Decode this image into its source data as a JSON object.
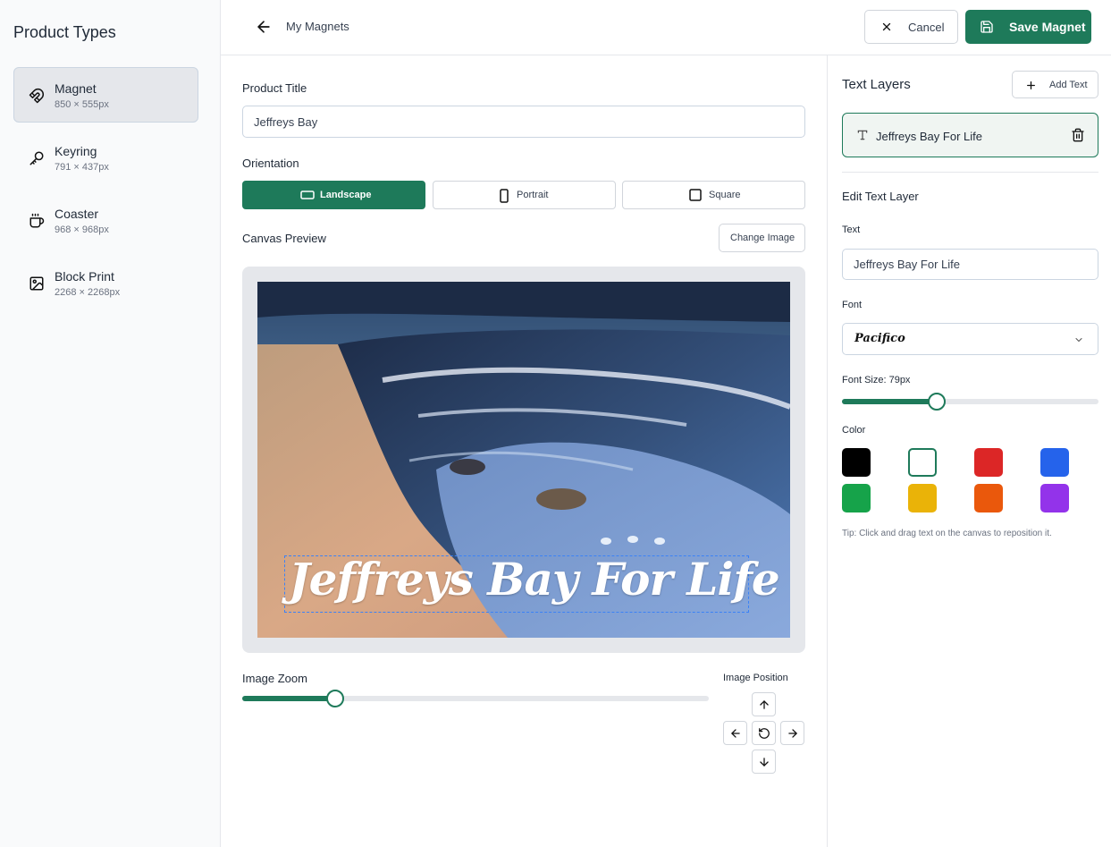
{
  "sidebar": {
    "title": "Product Types",
    "items": [
      {
        "name": "Magnet",
        "dims": "850 × 555px",
        "icon": "magnet-icon"
      },
      {
        "name": "Keyring",
        "dims": "791 × 437px",
        "icon": "key-icon"
      },
      {
        "name": "Coaster",
        "dims": "968 × 968px",
        "icon": "mug-icon"
      },
      {
        "name": "Block Print",
        "dims": "2268 × 2268px",
        "icon": "image-icon"
      }
    ],
    "active_index": 0
  },
  "header": {
    "breadcrumb": "My Magnets",
    "cancel_label": "Cancel",
    "save_label": "Save Magnet"
  },
  "editor": {
    "product_title_label": "Product Title",
    "product_title_value": "Jeffreys Bay",
    "orientation_label": "Orientation",
    "orientations": [
      {
        "label": "Landscape",
        "active": true
      },
      {
        "label": "Portrait",
        "active": false
      },
      {
        "label": "Square",
        "active": false
      }
    ],
    "canvas_preview_label": "Canvas Preview",
    "change_image_label": "Change Image",
    "canvas_text": "Jeffreys Bay For Life",
    "image_zoom_label": "Image Zoom",
    "image_zoom_value": 0.2,
    "image_position_label": "Image Position"
  },
  "text_layers": {
    "title": "Text Layers",
    "add_text_label": "Add Text",
    "layers": [
      {
        "name": "Jeffreys Bay For Life",
        "selected": true
      }
    ],
    "edit_title": "Edit Text Layer",
    "text_label": "Text",
    "text_value": "Jeffreys Bay For Life",
    "font_label": "Font",
    "font_value": "Pacifico",
    "font_size_label": "Font Size: 79px",
    "font_size_fraction": 0.37,
    "color_label": "Color",
    "colors": [
      "#000000",
      "#ffffff",
      "#dc2626",
      "#2563eb",
      "#16a34a",
      "#eab308",
      "#ea580c",
      "#9333ea"
    ],
    "selected_color_index": 1,
    "tip": "Tip: Click and drag text on the canvas to reposition it."
  },
  "theme": {
    "accent": "#1e7a5a"
  }
}
